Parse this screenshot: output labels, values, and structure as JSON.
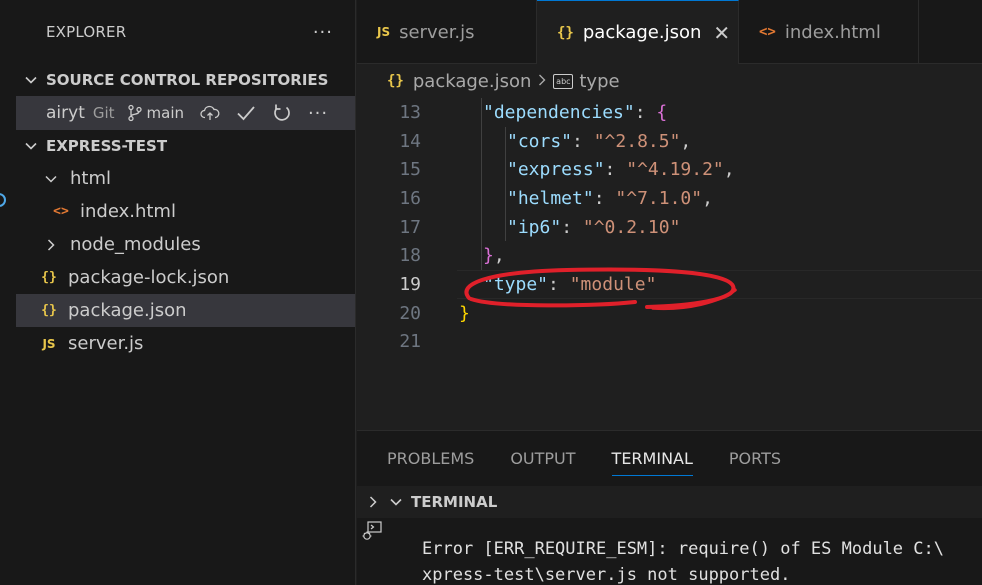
{
  "sidebar": {
    "title": "EXPLORER",
    "more": "···",
    "source_control": {
      "heading": "SOURCE CONTROL REPOSITORIES",
      "repo_name": "airyt",
      "repo_kind": "Git",
      "branch": "main",
      "more": "···"
    },
    "workspace": {
      "heading": "EXPRESS-TEST",
      "items": [
        {
          "label": "html",
          "type": "folder-open"
        },
        {
          "label": "index.html",
          "type": "html"
        },
        {
          "label": "node_modules",
          "type": "folder-closed"
        },
        {
          "label": "package-lock.json",
          "type": "json"
        },
        {
          "label": "package.json",
          "type": "json"
        },
        {
          "label": "server.js",
          "type": "js"
        }
      ]
    }
  },
  "tabs": [
    {
      "label": "server.js",
      "icon": "JS"
    },
    {
      "label": "package.json",
      "icon": "{}"
    },
    {
      "label": "index.html",
      "icon": "<>"
    }
  ],
  "tab_close": "✕",
  "icons": {
    "json": "{}",
    "js": "JS",
    "html": "<>"
  },
  "breadcrumb": {
    "file": "package.json",
    "symbol": "type",
    "symbol_icon": "abc"
  },
  "code": {
    "current_line": 19,
    "lines": [
      {
        "num": "13",
        "key": "\"dependencies\"",
        "punct": ": ",
        "open": "{"
      },
      {
        "num": "14",
        "key": "\"cors\"",
        "punct": ": ",
        "value": "\"^2.8.5\"",
        "tail": ","
      },
      {
        "num": "15",
        "key": "\"express\"",
        "punct": ": ",
        "value": "\"^4.19.2\"",
        "tail": ","
      },
      {
        "num": "16",
        "key": "\"helmet\"",
        "punct": ": ",
        "value": "\"^7.1.0\"",
        "tail": ","
      },
      {
        "num": "17",
        "key": "\"ip6\"",
        "punct": ": ",
        "value": "\"^0.2.10\""
      },
      {
        "num": "18",
        "close": "}",
        "tail": ","
      },
      {
        "num": "19",
        "key": "\"type\"",
        "punct": ": ",
        "value": "\"module\""
      },
      {
        "num": "20",
        "close": "}"
      },
      {
        "num": "21"
      }
    ]
  },
  "panel": {
    "tabs": [
      "PROBLEMS",
      "OUTPUT",
      "TERMINAL",
      "PORTS"
    ],
    "active_tab": "TERMINAL",
    "terminal_heading": "TERMINAL",
    "terminal_lines": [
      "Error [ERR_REQUIRE_ESM]: require() of ES Module C:\\",
      "xpress-test\\server.js not supported."
    ]
  },
  "colors": {
    "accent": "#0078d4",
    "annotation": "#e0202a",
    "json_key": "#9cdcfe",
    "json_string": "#ce9178",
    "bracket_gold": "#ffd700",
    "bracket_purple": "#da70d6"
  }
}
